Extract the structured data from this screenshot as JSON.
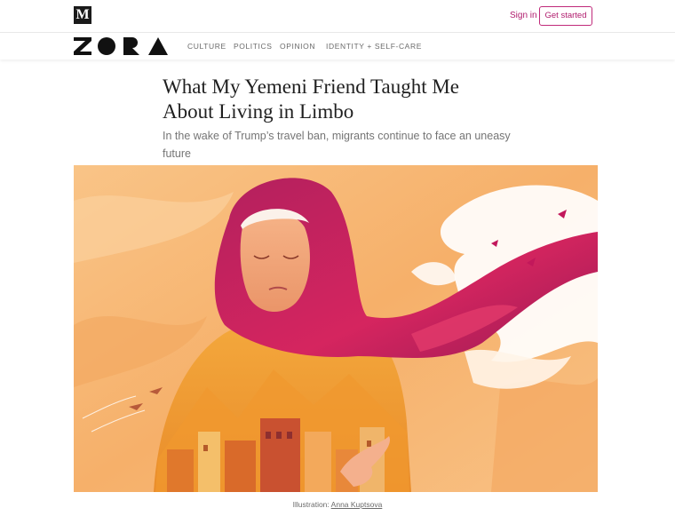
{
  "header": {
    "logo_letter": "M",
    "signin_label": "Sign in",
    "get_started_label": "Get started"
  },
  "publication": {
    "logo_alt": "ZORA",
    "nav": [
      "CULTURE",
      "POLITICS",
      "OPINION",
      "IDENTITY + SELF-CARE"
    ]
  },
  "article": {
    "title_line1": "What My Yemeni Friend Taught Me",
    "title_line2": "About Living in Limbo",
    "subtitle": "In the wake of Trump’s travel ban, migrants continue to face an uneasy future"
  },
  "image": {
    "caption_prefix": "Illustration: ",
    "caption_author": "Anna Kuptsova"
  },
  "colors": {
    "accent": "#b01c6d",
    "hero_background": "#f7b978",
    "hijab": "#c2185b"
  }
}
